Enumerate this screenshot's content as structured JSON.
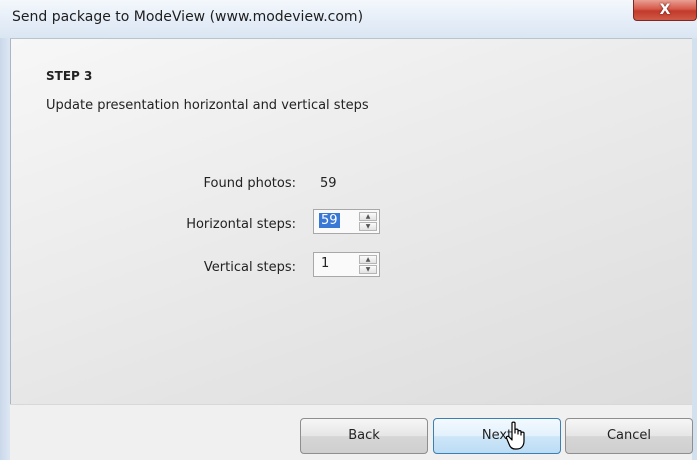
{
  "window": {
    "title": "Send package to ModeView (www.modeview.com)",
    "close_symbol": "X"
  },
  "step": {
    "title": "STEP 3",
    "description": "Update presentation horizontal and vertical steps"
  },
  "form": {
    "found_photos_label": "Found photos:",
    "found_photos_value": "59",
    "horizontal_label": "Horizontal steps:",
    "horizontal_value": "59",
    "vertical_label": "Vertical steps:",
    "vertical_value": "1"
  },
  "buttons": {
    "back": "Back",
    "next": "Next",
    "cancel": "Cancel"
  },
  "icons": {
    "close": "close-icon",
    "spin_up": "spin-up-arrow-icon",
    "spin_down": "spin-down-arrow-icon",
    "cursor": "hand-pointer-cursor-icon"
  }
}
